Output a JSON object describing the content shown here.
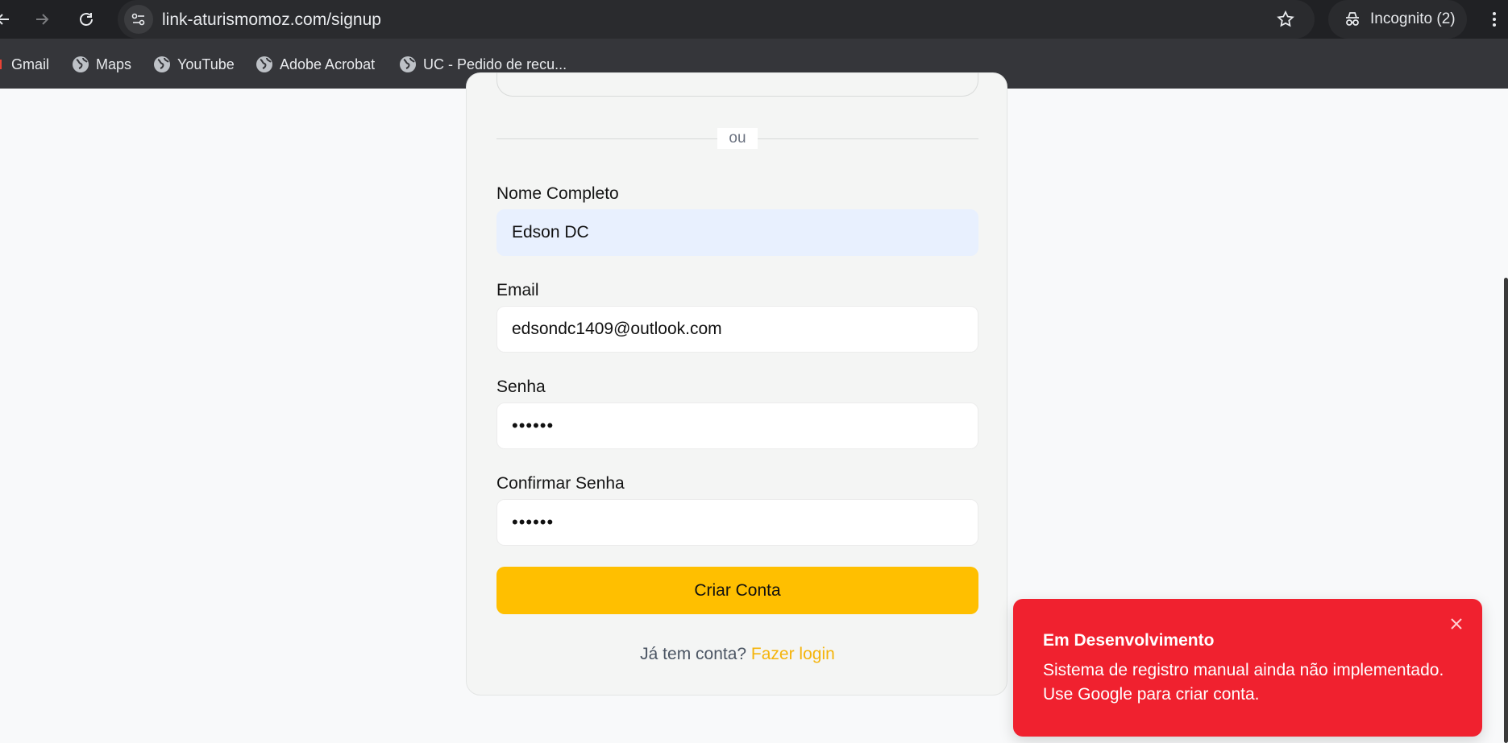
{
  "browser": {
    "url": "link-aturismomoz.com/signup",
    "profile_label": "Incognito (2)",
    "bookmarks": [
      {
        "label": "Gmail",
        "icon": "gmail-icon"
      },
      {
        "label": "Maps",
        "icon": "globe-icon"
      },
      {
        "label": "YouTube",
        "icon": "globe-icon"
      },
      {
        "label": "Adobe Acrobat",
        "icon": "globe-icon"
      },
      {
        "label": "UC - Pedido de recu...",
        "icon": "globe-icon"
      }
    ]
  },
  "form": {
    "divider_text": "ou",
    "name_label": "Nome Completo",
    "name_value": "Edson DC",
    "email_label": "Email",
    "email_value": "edsondc1409@outlook.com",
    "password_label": "Senha",
    "password_value": "••••••",
    "confirm_label": "Confirmar Senha",
    "confirm_value": "••••••",
    "submit_label": "Criar Conta",
    "signin_prompt": "Já tem conta?",
    "signin_link": "Fazer login"
  },
  "toast": {
    "title": "Em Desenvolvimento",
    "message": "Sistema de registro manual ainda não implementado. Use Google para criar conta."
  },
  "colors": {
    "accent": "#ffbf00",
    "toast_bg": "#f0212f",
    "link": "#f5b40a"
  }
}
